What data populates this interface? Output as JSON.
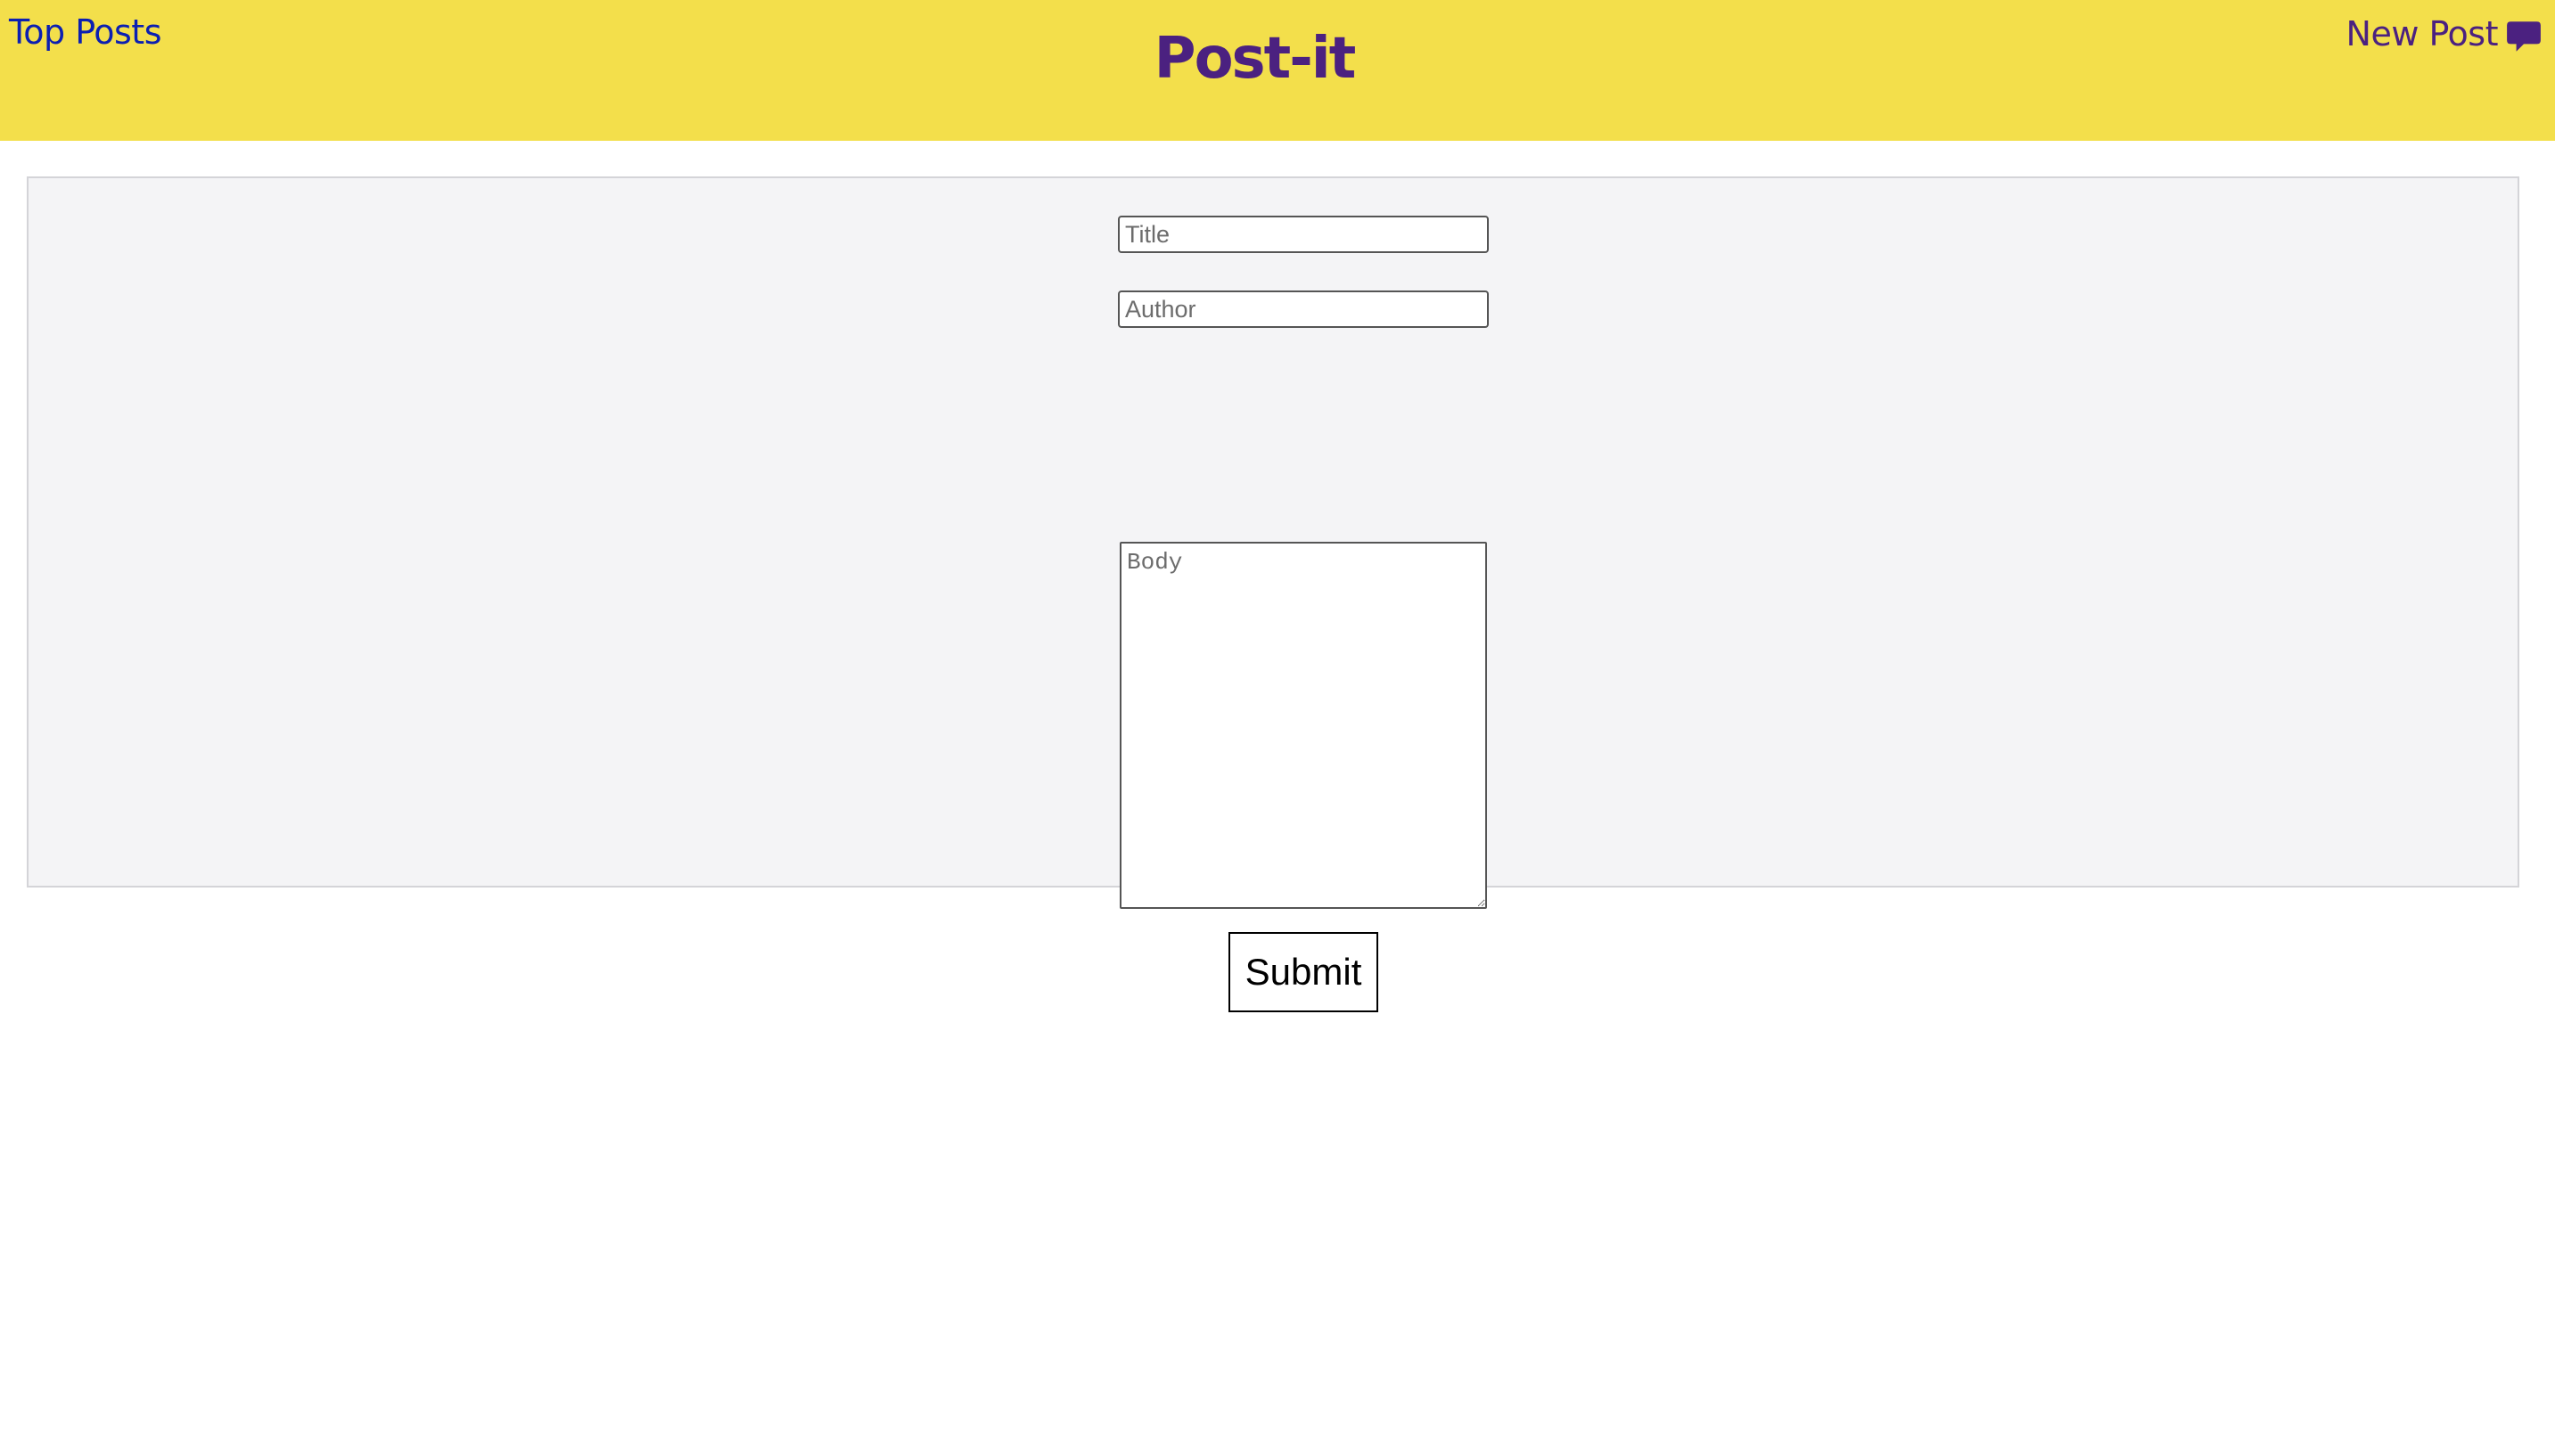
{
  "header": {
    "background": "#f3df4b",
    "left_link": "Top Posts",
    "title": "Post-it",
    "right_link": "New Post",
    "right_icon": "chat-bubble-icon",
    "accent_color": "#4b2180",
    "link_color": "#0b1fb2"
  },
  "form": {
    "title_placeholder": "Title",
    "author_placeholder": "Author",
    "body_placeholder": "Body",
    "submit_label": "Submit"
  }
}
